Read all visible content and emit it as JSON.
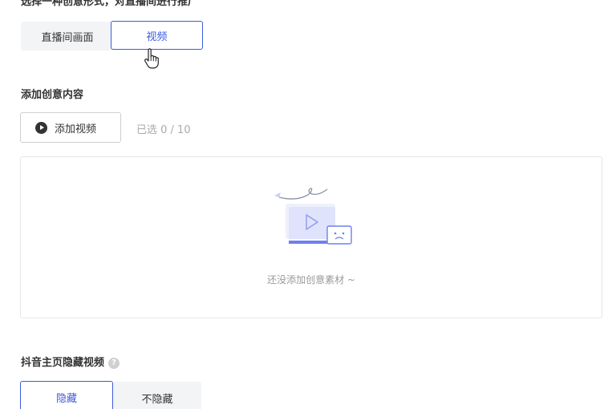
{
  "form_type": {
    "title": "选择一种创意形式，对直播间进行推广",
    "options": [
      {
        "label": "直播间画面",
        "selected": false
      },
      {
        "label": "视频",
        "selected": true
      }
    ]
  },
  "creative_content": {
    "title": "添加创意内容",
    "add_button_label": "添加视频",
    "selected_count": "已选 0 / 10",
    "empty_text": "还没添加创意素材 ~"
  },
  "douyin_hide": {
    "title": "抖音主页隐藏视频",
    "help_icon": "question-circle-icon",
    "options": [
      {
        "label": "隐藏",
        "selected": true
      },
      {
        "label": "不隐藏",
        "selected": false
      }
    ]
  },
  "colors": {
    "accent": "#3b5bdb",
    "muted_text": "#999999",
    "border": "#e5e5e5"
  }
}
